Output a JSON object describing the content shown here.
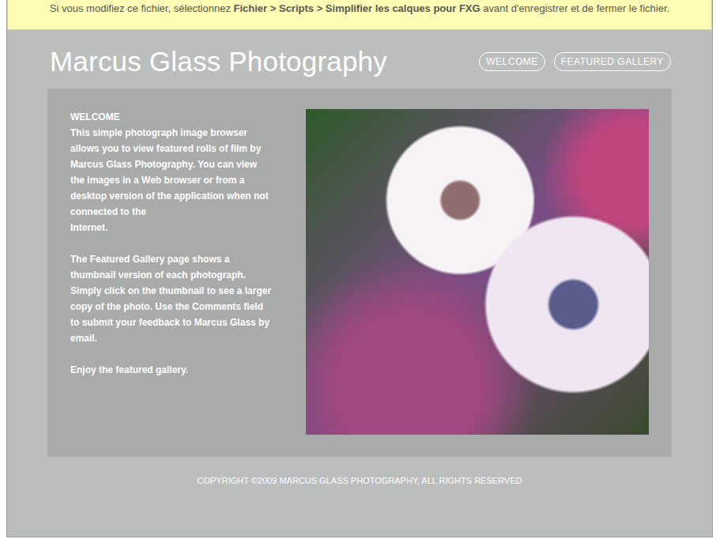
{
  "banner": {
    "segments": [
      {
        "text": "Si vous modifiez ce fichier, sélectionnez ",
        "bold": false
      },
      {
        "text": "Fichier > Scripts > Simplifier les calques pour FXG",
        "bold": true
      },
      {
        "text": " avant d'enregistrer et de fermer le fichier.",
        "bold": false
      }
    ]
  },
  "site": {
    "title": "Marcus Glass Photography"
  },
  "nav": [
    {
      "label": "WELCOME"
    },
    {
      "label": "FEATURED GALLERY"
    }
  ],
  "welcome": {
    "heading": "WELCOME",
    "paragraphs": [
      [
        "This simple photograph image browser",
        "allows you to view featured rolls of film by",
        "Marcus Glass Photography. You can view",
        "the images in a Web browser or from a",
        "desktop version of the application when not",
        "connected to the",
        "Internet."
      ],
      [
        "The Featured Gallery page shows a",
        "thumbnail version of each photograph.",
        "Simply click on the thumbnail to see a larger",
        "copy of the photo. Use the Comments field",
        "to submit your feedback to Marcus Glass by",
        "email."
      ],
      [
        "Enjoy the featured gallery."
      ]
    ]
  },
  "footer": {
    "text": "COPYRIGHT ©2009 MARCUS GLASS PHOTOGRAPHY, ALL RIGHTS RESERVED"
  }
}
